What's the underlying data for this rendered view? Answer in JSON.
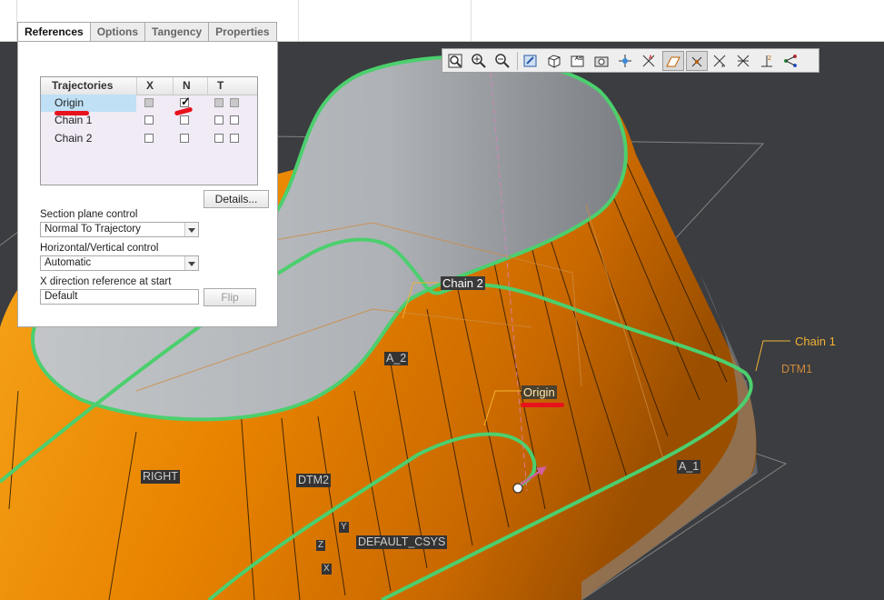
{
  "tabs": [
    "References",
    "Options",
    "Tangency",
    "Properties"
  ],
  "trajectories": {
    "headers": {
      "name": "Trajectories",
      "x": "X",
      "n": "N",
      "t": "T"
    },
    "rows": [
      {
        "label": "Origin",
        "x": "grey",
        "n": "checked",
        "t": "grey"
      },
      {
        "label": "Chain 1",
        "x": "empty",
        "n": "empty",
        "t": "empty"
      },
      {
        "label": "Chain 2",
        "x": "empty",
        "n": "empty",
        "t": "empty"
      }
    ]
  },
  "details_label": "Details...",
  "section_plane": {
    "label": "Section plane control",
    "value": "Normal To Trajectory"
  },
  "hv_control": {
    "label": "Horizontal/Vertical control",
    "value": "Automatic"
  },
  "xdir": {
    "label": "X direction reference at start",
    "value": "Default",
    "flip_label": "Flip"
  },
  "toolbar_icons": [
    "refit-icon",
    "zoom-in-icon",
    "zoom-out-icon",
    "repaint-icon",
    "saved-views-icon",
    "annotation-display-icon",
    "render-icon",
    "spin-center-icon",
    "axis-display-icon",
    "plane-display-icon",
    "point-display-icon",
    "csys-display-icon",
    "point-tag-icon",
    "csys-tag-icon",
    "annotation-icon",
    "network-icon"
  ],
  "scene": {
    "chain2": "Chain 2",
    "chain1": "Chain 1",
    "origin": "Origin",
    "a2": "A_2",
    "a1": "A_1",
    "dtm1": "DTM1",
    "dtm2": "DTM2",
    "right": "RIGHT",
    "csys": "DEFAULT_CSYS",
    "axis_y": "Y",
    "axis_z": "Z",
    "axis_x": "X"
  },
  "colors": {
    "orange": "#f08a00",
    "chain": "#44cc66",
    "background": "#3b3d40",
    "accent_yellow": "#f2b233"
  }
}
